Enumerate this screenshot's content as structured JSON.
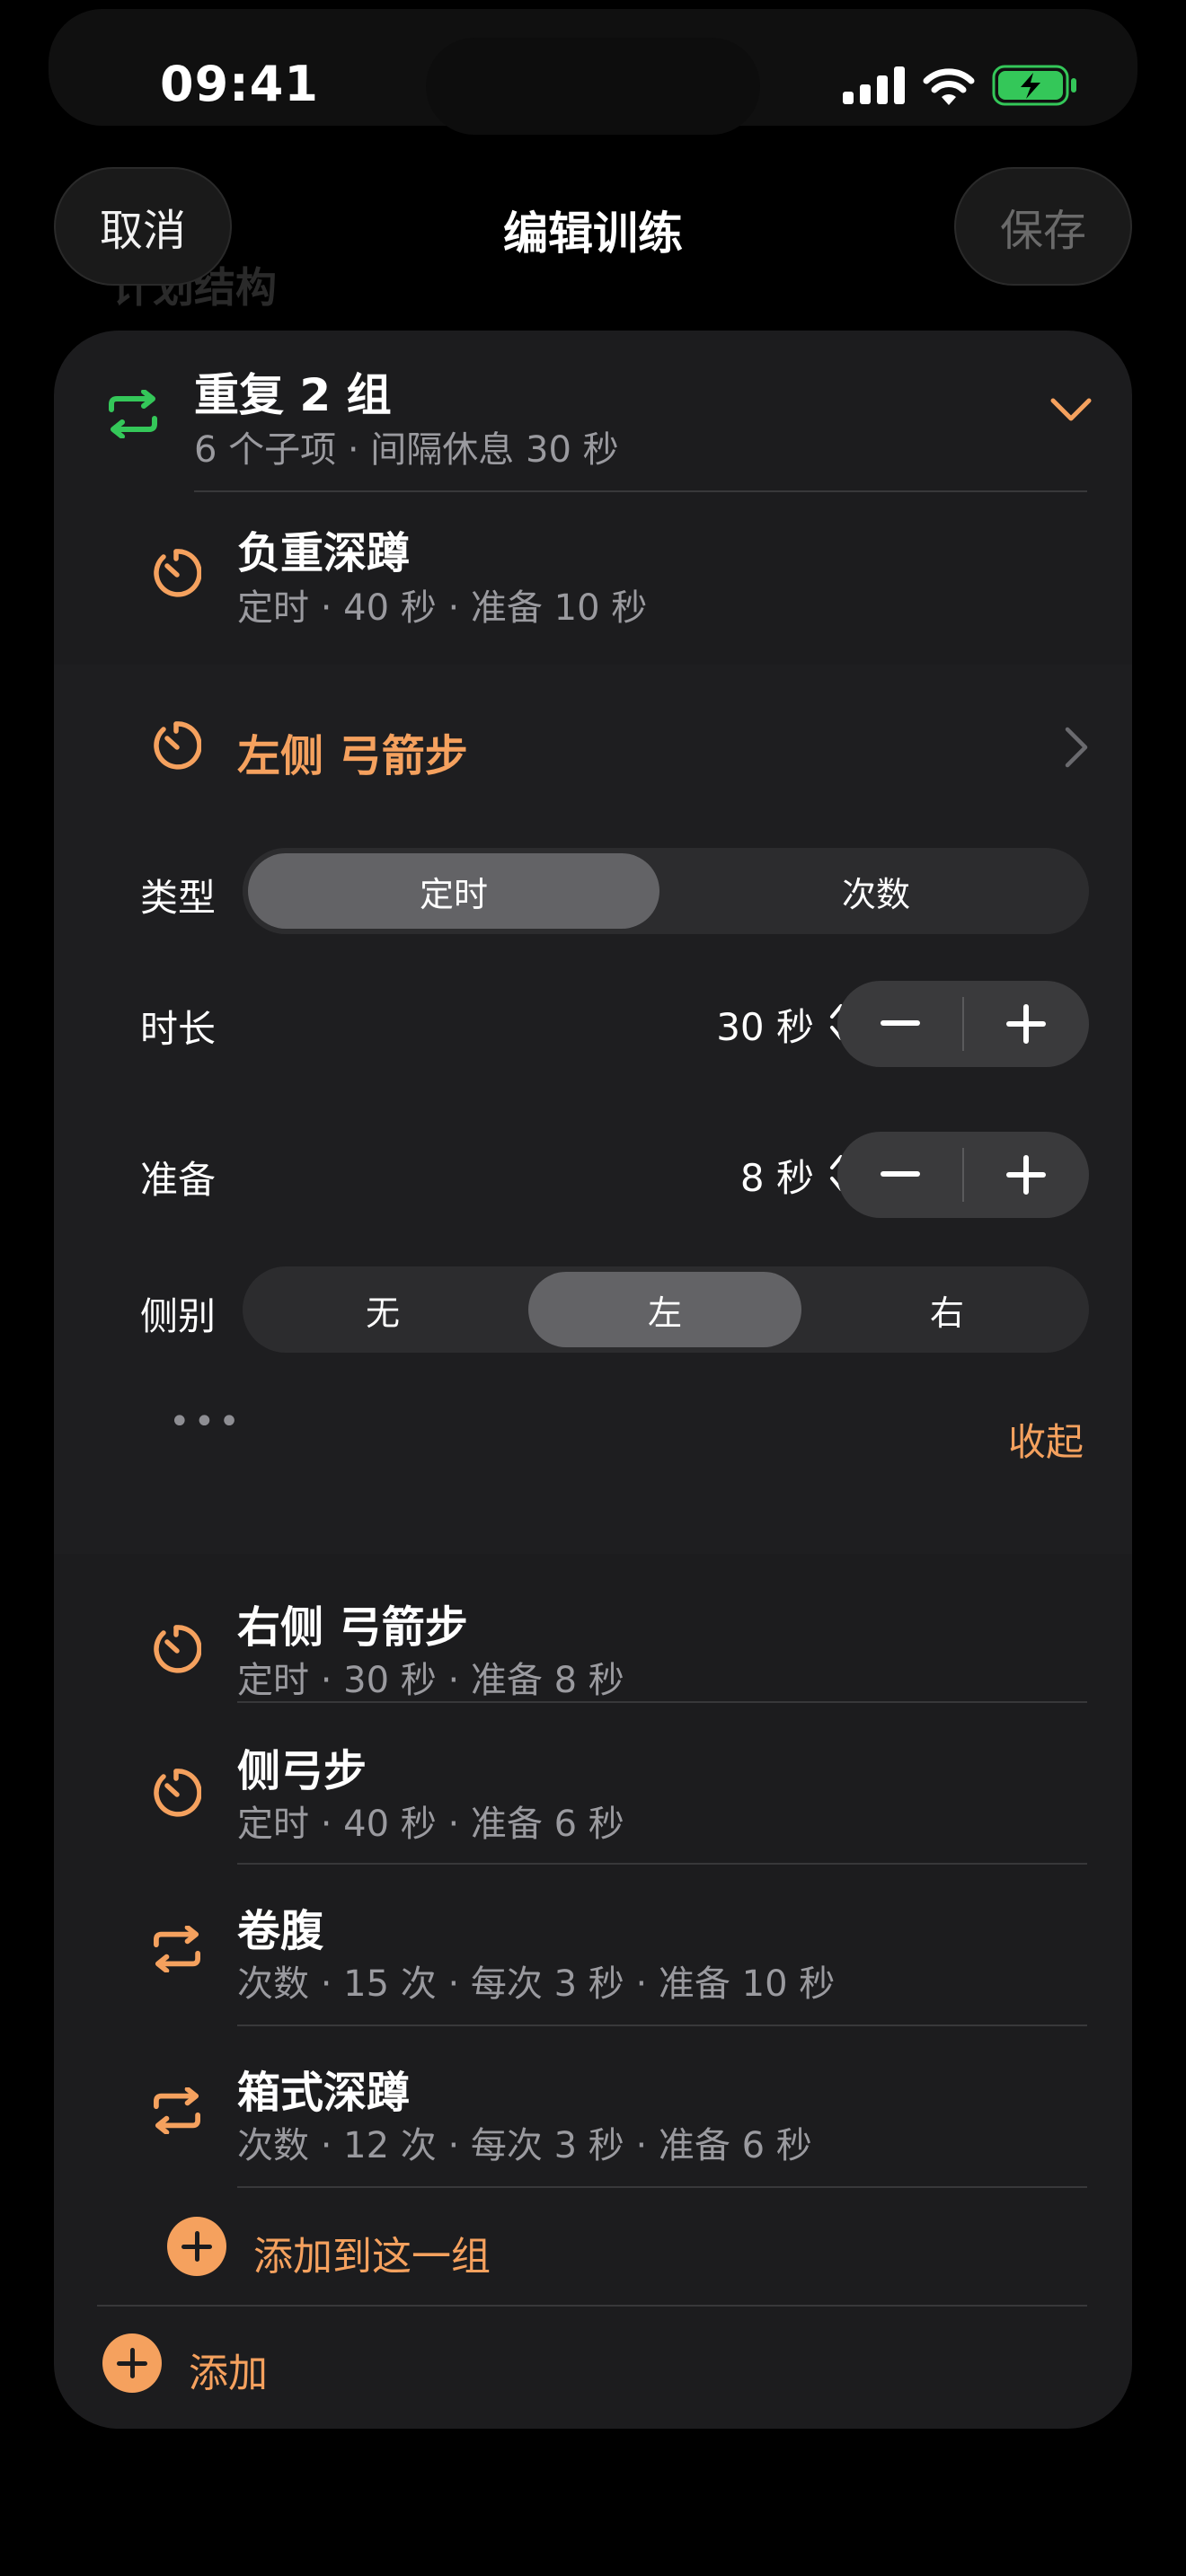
{
  "status": {
    "time": "09:41"
  },
  "nav": {
    "cancel": "取消",
    "title": "编辑训练",
    "save": "保存"
  },
  "behind": {
    "section_title": "计划结构"
  },
  "group": {
    "title": "重复 2 组",
    "subtitle": "6 个子项 · 间隔休息 30 秒",
    "items": [
      {
        "title": "负重深蹲",
        "subtitle": "定时 · 40 秒 · 准备 10 秒",
        "icon": "timer-icon"
      },
      {
        "title": "右侧 弓箭步",
        "subtitle": "定时 · 30 秒 · 准备 8 秒",
        "icon": "timer-icon"
      },
      {
        "title": "侧弓步",
        "subtitle": "定时 · 40 秒 · 准备 6 秒",
        "icon": "timer-icon"
      },
      {
        "title": "卷腹",
        "subtitle": "次数 · 15 次 · 每次 3 秒 · 准备 10 秒",
        "icon": "repeat-icon"
      },
      {
        "title": "箱式深蹲",
        "subtitle": "次数 · 12 次 · 每次 3 秒 · 准备 6 秒",
        "icon": "repeat-icon"
      }
    ],
    "add_to_group": "添加到这一组"
  },
  "expanded": {
    "title": "左侧 弓箭步",
    "type_label": "类型",
    "type_options": [
      "定时",
      "次数"
    ],
    "type_selected": "定时",
    "duration_label": "时长",
    "duration_value": "30 秒",
    "prepare_label": "准备",
    "prepare_value": "8 秒",
    "side_label": "侧别",
    "side_options": [
      "无",
      "左",
      "右"
    ],
    "side_selected": "左",
    "more": "•••",
    "collapse": "收起"
  },
  "footer": {
    "add": "添加"
  },
  "colors": {
    "accent": "#F5A15E",
    "repeat_green": "#34C759",
    "card_bg": "#1C1C1E",
    "battery_green": "#34C759"
  }
}
